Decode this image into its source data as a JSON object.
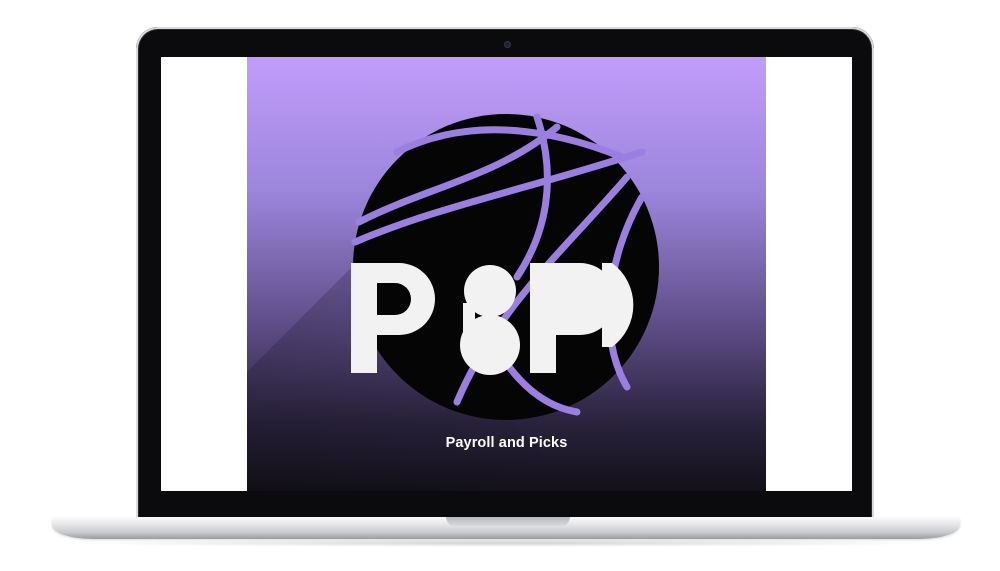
{
  "device": {
    "type": "laptop"
  },
  "screen": {
    "logo": {
      "letters": "P&P",
      "icon": "basketball-icon"
    },
    "tagline": "Payroll and Picks"
  },
  "colors": {
    "gradient_top": "#c19dfb",
    "gradient_bottom": "#121018",
    "ball": "#050505",
    "seam": "#9a7fe0",
    "letters": "#f2f2f2"
  }
}
